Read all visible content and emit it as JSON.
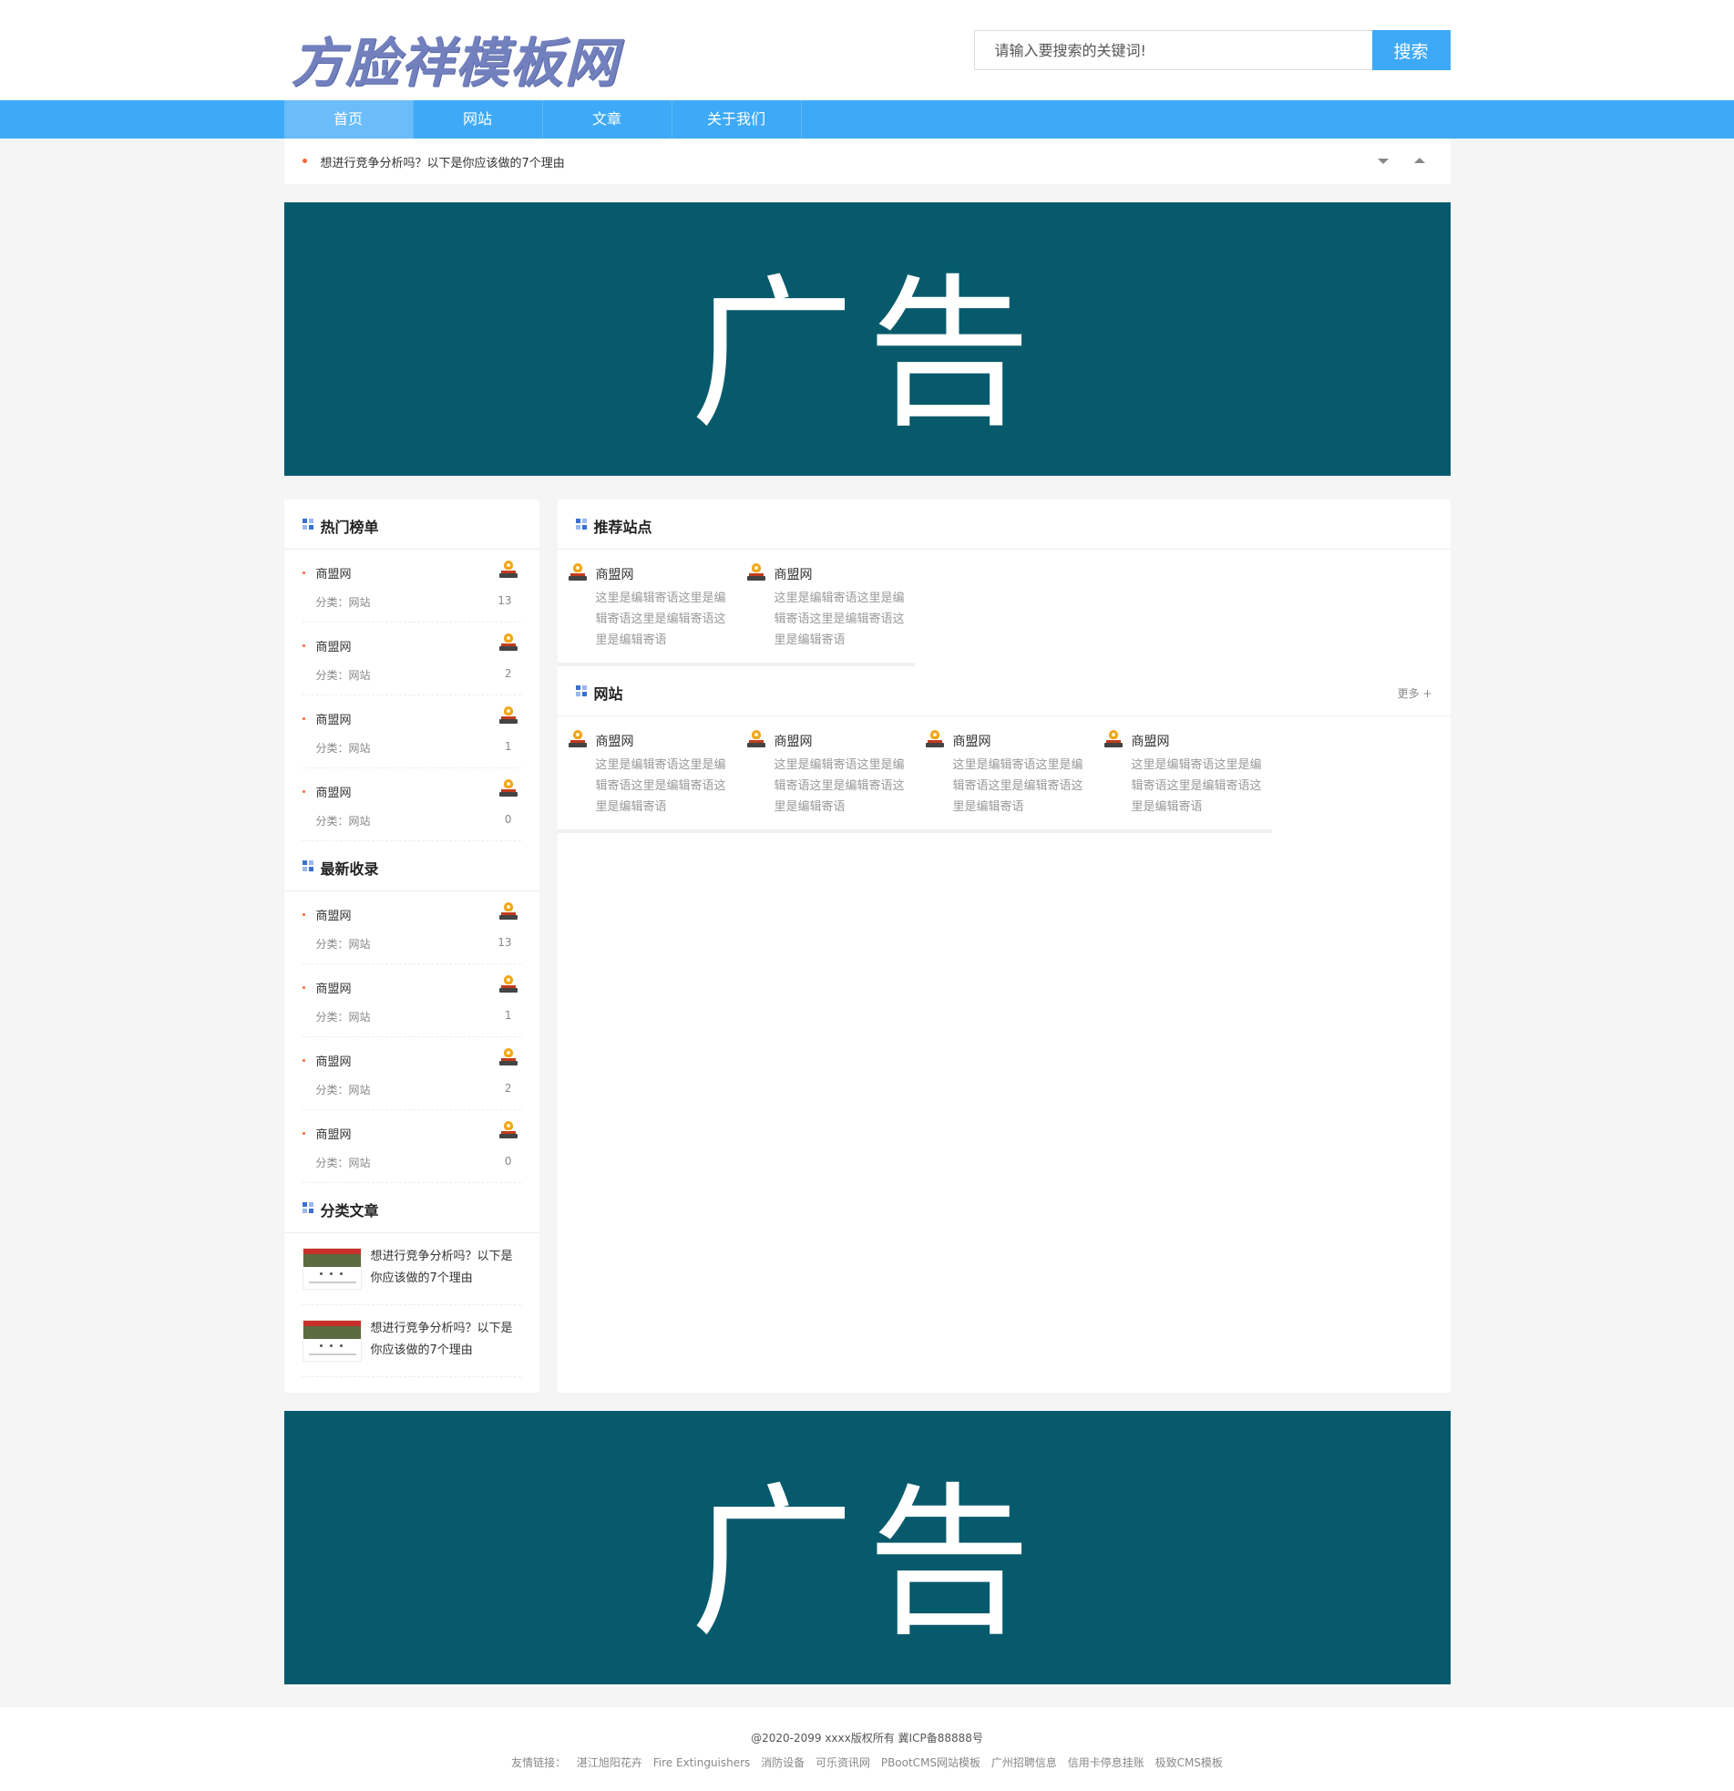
{
  "header": {
    "logo_text": "方脸祥模板网",
    "search_placeholder": "请输入要搜索的关键词!",
    "search_button": "搜索"
  },
  "nav": {
    "items": [
      "首页",
      "网站",
      "文章",
      "关于我们"
    ],
    "active_index": 0
  },
  "notice": {
    "text": "想进行竞争分析吗？以下是你应该做的7个理由"
  },
  "ads": {
    "top": "广告",
    "bottom": "广告"
  },
  "hot_list": {
    "title": "热门榜单",
    "items": [
      {
        "name": "商盟网",
        "category": "分类：网站",
        "count": "13"
      },
      {
        "name": "商盟网",
        "category": "分类：网站",
        "count": "2"
      },
      {
        "name": "商盟网",
        "category": "分类：网站",
        "count": "1"
      },
      {
        "name": "商盟网",
        "category": "分类：网站",
        "count": "0"
      }
    ]
  },
  "latest_list": {
    "title": "最新收录",
    "items": [
      {
        "name": "商盟网",
        "category": "分类：网站",
        "count": "13"
      },
      {
        "name": "商盟网",
        "category": "分类：网站",
        "count": "1"
      },
      {
        "name": "商盟网",
        "category": "分类：网站",
        "count": "2"
      },
      {
        "name": "商盟网",
        "category": "分类：网站",
        "count": "0"
      }
    ]
  },
  "category_articles": {
    "title": "分类文章",
    "items": [
      {
        "title": "想进行竞争分析吗？以下是你应该做的7个理由"
      },
      {
        "title": "想进行竞争分析吗？以下是你应该做的7个理由"
      }
    ]
  },
  "recommended": {
    "title": "推荐站点",
    "sites": [
      {
        "name": "商盟网",
        "desc": "这里是编辑寄语这里是编辑寄语这里是编辑寄语这里是编辑寄语"
      },
      {
        "name": "商盟网",
        "desc": "这里是编辑寄语这里是编辑寄语这里是编辑寄语这里是编辑寄语"
      }
    ]
  },
  "websites": {
    "title": "网站",
    "more": "更多 +",
    "sites": [
      {
        "name": "商盟网",
        "desc": "这里是编辑寄语这里是编辑寄语这里是编辑寄语这里是编辑寄语"
      },
      {
        "name": "商盟网",
        "desc": "这里是编辑寄语这里是编辑寄语这里是编辑寄语这里是编辑寄语"
      },
      {
        "name": "商盟网",
        "desc": "这里是编辑寄语这里是编辑寄语这里是编辑寄语这里是编辑寄语"
      },
      {
        "name": "商盟网",
        "desc": "这里是编辑寄语这里是编辑寄语这里是编辑寄语这里是编辑寄语"
      }
    ]
  },
  "footer": {
    "copyright": "@2020-2099 xxxx版权所有 冀ICP备88888号",
    "links_label": "友情链接：",
    "links": [
      "湛江旭阳花卉",
      "Fire Extinguishers",
      "消防设备",
      "可乐资讯网",
      "PBootCMS网站模板",
      "广州招聘信息",
      "信用卡停息挂账",
      "极致CMS模板"
    ]
  },
  "colors": {
    "brand_blue": "#3eaaf7",
    "ad_bg": "#075a6b",
    "logo": "#7281be"
  }
}
